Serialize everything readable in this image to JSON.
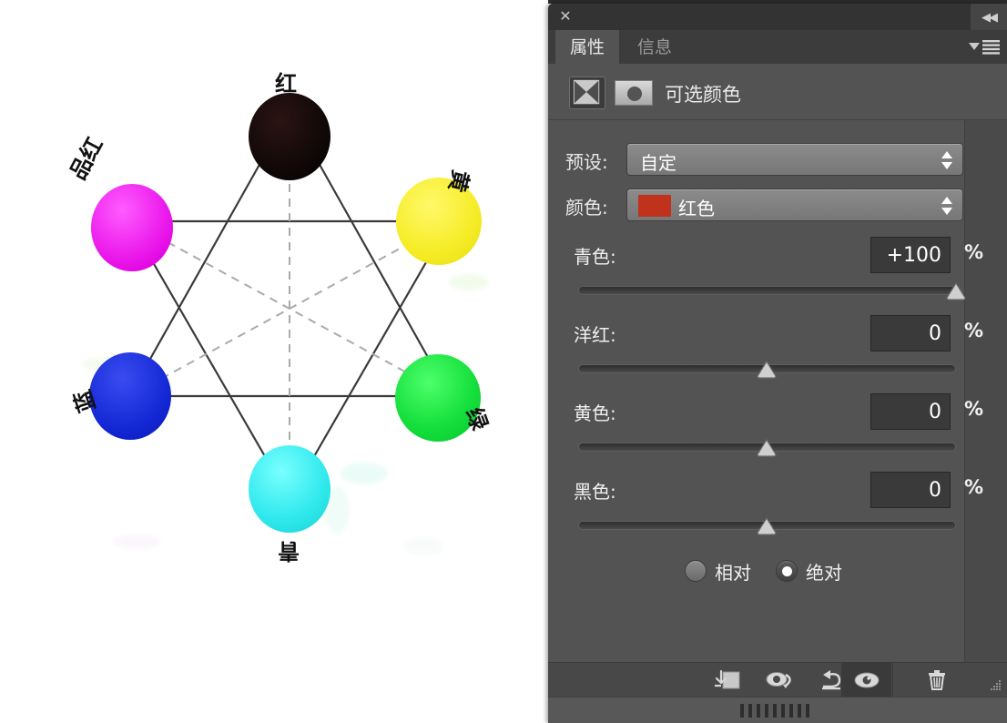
{
  "panel": {
    "close_icon": "close-icon",
    "collapse_icon": "◀◀",
    "tabs": [
      {
        "label": "属性",
        "active": true
      },
      {
        "label": "信息",
        "active": false
      }
    ],
    "adjustment_title": "可选颜色",
    "adjustment_icon": "selective-color-icon",
    "mask_icon": "layer-mask-thumbnail",
    "menu_icon": "panel-menu-icon",
    "fields": [
      {
        "label": "预设:",
        "value": "自定",
        "swatch": null
      },
      {
        "label": "颜色:",
        "value": "红色",
        "swatch": "#c0321b"
      }
    ],
    "sliders": [
      {
        "label": "青色:",
        "value": "+100",
        "unit": "%",
        "percent": 100,
        "min": -100,
        "max": 100
      },
      {
        "label": "洋红:",
        "value": "0",
        "unit": "%",
        "percent": 0,
        "min": -100,
        "max": 100
      },
      {
        "label": "黄色:",
        "value": "0",
        "unit": "%",
        "percent": 0,
        "min": -100,
        "max": 100
      },
      {
        "label": "黑色:",
        "value": "0",
        "unit": "%",
        "percent": 0,
        "min": -100,
        "max": 100
      }
    ],
    "method": {
      "relative_label": "相对",
      "absolute_label": "绝对",
      "selected": "absolute"
    },
    "footer_buttons": [
      {
        "name": "clip-to-layer-button",
        "icon": "clip-to-layer-icon",
        "active": false
      },
      {
        "name": "toggle-previous-state-button",
        "icon": "eye-arrow-icon",
        "active": false
      },
      {
        "name": "reset-button",
        "icon": "reset-arrow-icon",
        "active": false
      },
      {
        "name": "toggle-visibility-button",
        "icon": "eye-icon",
        "active": true
      },
      {
        "name": "delete-layer-button",
        "icon": "trash-icon",
        "active": false
      }
    ]
  },
  "diagram": {
    "type": "color-wheel",
    "nodes": [
      {
        "label": "红",
        "color": "#120909",
        "angle_deg": 90,
        "name": "node-red"
      },
      {
        "label": "黄",
        "color": "#f4ec2a",
        "angle_deg": 30,
        "name": "node-yellow"
      },
      {
        "label": "绿",
        "color": "#16dd3c",
        "angle_deg": -30,
        "name": "node-green"
      },
      {
        "label": "青",
        "color": "#2ee8ec",
        "angle_deg": -90,
        "name": "node-cyan"
      },
      {
        "label": "蓝",
        "color": "#1428d6",
        "angle_deg": 210,
        "name": "node-blue"
      },
      {
        "label": "品红",
        "color": "#ea1fea",
        "angle_deg": 150,
        "name": "node-magenta"
      }
    ],
    "solid_triangle_nodes": [
      "红",
      "绿",
      "蓝"
    ],
    "dashed_triangle_nodes": [
      "黄",
      "青",
      "品红"
    ]
  }
}
